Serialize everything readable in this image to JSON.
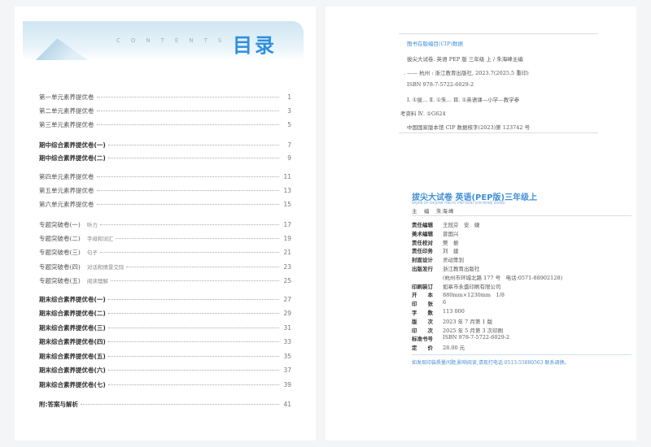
{
  "toc": {
    "header_en": "CONTENTS",
    "header_cn": "目录",
    "items": [
      {
        "title": "第一单元素养提优卷",
        "page": "1"
      },
      {
        "title": "第二单元素养提优卷",
        "page": "3"
      },
      {
        "title": "第三单元素养提优卷",
        "page": "5"
      },
      {
        "title": "期中综合素养提优卷(一)",
        "page": "7",
        "bold": true
      },
      {
        "title": "期中综合素养提优卷(二)",
        "page": "9",
        "bold": true
      },
      {
        "title": "第四单元素养提优卷",
        "page": "11"
      },
      {
        "title": "第五单元素养提优卷",
        "page": "13"
      },
      {
        "title": "第六单元素养提优卷",
        "page": "15"
      },
      {
        "title": "专题突破卷(一)",
        "sub": "听力",
        "page": "17"
      },
      {
        "title": "专题突破卷(二)",
        "sub": "字母和词汇",
        "page": "19"
      },
      {
        "title": "专题突破卷(三)",
        "sub": "句子",
        "page": "21"
      },
      {
        "title": "专题突破卷(四)",
        "sub": "对话和情景交际",
        "page": "23"
      },
      {
        "title": "专题突破卷(五)",
        "sub": "阅读理解",
        "page": "25"
      },
      {
        "title": "期末综合素养提优卷(一)",
        "page": "27",
        "bold": true
      },
      {
        "title": "期末综合素养提优卷(二)",
        "page": "29",
        "bold": true
      },
      {
        "title": "期末综合素养提优卷(三)",
        "page": "31",
        "bold": true
      },
      {
        "title": "期末综合素养提优卷(四)",
        "page": "33",
        "bold": true
      },
      {
        "title": "期末综合素养提优卷(五)",
        "page": "35",
        "bold": true
      },
      {
        "title": "期末综合素养提优卷(六)",
        "page": "37",
        "bold": true
      },
      {
        "title": "期末综合素养提优卷(七)",
        "page": "39",
        "bold": true
      },
      {
        "title": "附:答案与解析",
        "page": "41",
        "bold": true
      }
    ]
  },
  "cip": {
    "heading": "图书在版编目(CIP)数据",
    "lines": [
      "拔尖大试卷. 英语 PEP 版 三年级 上 / 朱海峰主编",
      ". —— 杭州 : 浙江教育出版社, 2023.7(2025.5 重印)",
      "ISBN 978-7-5722-6029-2",
      "Ⅰ. ①拔… Ⅱ. ①朱… Ⅲ. ①英语课—小学—教学参",
      "考资料 Ⅳ. ①G624",
      "中国国家版本馆 CIP 数据核字(2023)第 123742 号"
    ]
  },
  "colophon": {
    "title": "拔尖大试卷 英语(PEP版)三年级上",
    "pinyin": "BAJIAN DA SHIJUAN YINGYU (PEP BAN) SAN NIANJI SHANG",
    "editor": "主　编　朱海峰",
    "rows": [
      {
        "k": "责任编辑",
        "v": "王冠芬　安　婕"
      },
      {
        "k": "美术编辑",
        "v": "曾国兴"
      },
      {
        "k": "责任校对",
        "v": "樊　振"
      },
      {
        "k": "责任印务",
        "v": "刘　建"
      },
      {
        "k": "封面设计",
        "v": "灵动策划"
      },
      {
        "k": "出版发行",
        "v": "浙江教育出版社"
      },
      {
        "k": "",
        "v": "(杭州市环城北路 177 号　电话:0571-88902128)"
      },
      {
        "k": "印刷装订",
        "v": "如皋市永盛印刷有限公司"
      },
      {
        "k": "开　　本",
        "v": "880mm×1230mm　1/8"
      },
      {
        "k": "印　　张",
        "v": "6"
      },
      {
        "k": "字　　数",
        "v": "113 000"
      },
      {
        "k": "版　　次",
        "v": "2023 年 7 月第 1 版"
      },
      {
        "k": "印　　次",
        "v": "2025 年 5 月第 3 次印刷"
      },
      {
        "k": "标准书号",
        "v": "ISBN 978-7-5722-6029-2"
      },
      {
        "k": "定　　价",
        "v": "28.00 元"
      }
    ],
    "note": "如发现印装质量问题,影响阅读,请现打电话 0513-55880563 联系调换。"
  },
  "colors": {
    "accent": "#2f8fe0"
  }
}
